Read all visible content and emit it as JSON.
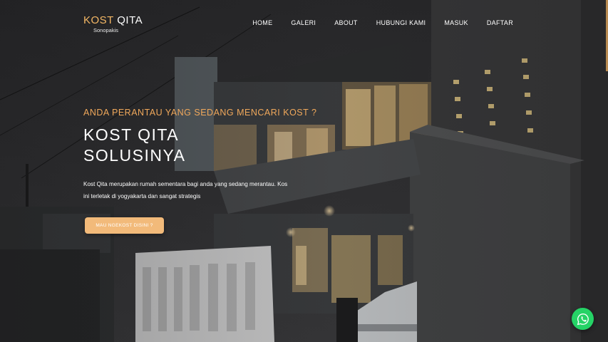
{
  "brand": {
    "name_part1": "KOST",
    "name_part2": "QITA",
    "subtitle": "Sonopakis"
  },
  "nav": {
    "items": [
      {
        "label": "HOME"
      },
      {
        "label": "GALERI"
      },
      {
        "label": "ABOUT"
      },
      {
        "label": "HUBUNGI KAMI"
      },
      {
        "label": "MASUK"
      },
      {
        "label": "DAFTAR"
      }
    ]
  },
  "hero": {
    "tagline": "ANDA PERANTAU YANG SEDANG MENCARI KOST ?",
    "headline_line1": "KOST QITA",
    "headline_line2": "SOLUSINYA",
    "description_line1": "Kost Qita merupakan rumah sementara bagi anda yang sedang merantau. Kos",
    "description_line2": "ini terletak di yogyakarta dan sangat strategis",
    "cta_label": "MAU NGEKOST DISINI ?"
  },
  "colors": {
    "accent": "#f0a85b",
    "button": "#f2ba7a",
    "whatsapp": "#25d366"
  },
  "icons": {
    "chat": "whatsapp-icon"
  }
}
